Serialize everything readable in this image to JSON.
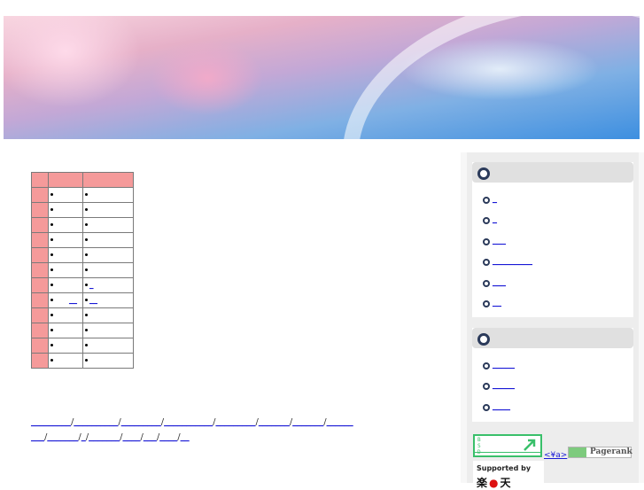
{
  "table": {
    "rows": [
      {
        "c1_link": "",
        "c2_link": ""
      },
      {
        "c1_link": "",
        "c2_link": ""
      },
      {
        "c1_link": "",
        "c2_link": ""
      },
      {
        "c1_link": "",
        "c2_link": ""
      },
      {
        "c1_link": "",
        "c2_link": ""
      },
      {
        "c1_link": "",
        "c2_link": ""
      },
      {
        "c1_link": "",
        "c2_link": "_"
      },
      {
        "c1_link": "__",
        "c2_link": "__"
      },
      {
        "c1_link": "",
        "c2_link": ""
      },
      {
        "c1_link": "",
        "c2_link": ""
      },
      {
        "c1_link": "",
        "c2_link": ""
      },
      {
        "c1_link": "",
        "c2_link": ""
      }
    ]
  },
  "footer": {
    "line1": [
      "_________",
      "__________",
      "_________",
      "___________",
      "_________",
      "_______",
      "_______",
      "______"
    ],
    "line2": [
      "___",
      "_______",
      "_",
      "_______",
      "____",
      "___",
      "____",
      "__"
    ]
  },
  "sidebar": {
    "box1_items": [
      "_",
      "_",
      "___",
      "_________",
      "___",
      "__"
    ],
    "box2_items": [
      "_____",
      "_____",
      "____"
    ]
  },
  "badge": {
    "letters": "B\nS\nD",
    "tiny_link": "<¥a>",
    "pagerank_label": "Pagerank",
    "supported_by": "Supported by",
    "logo_text": "楽",
    "logo_red": "●",
    "logo_tail": "天"
  }
}
